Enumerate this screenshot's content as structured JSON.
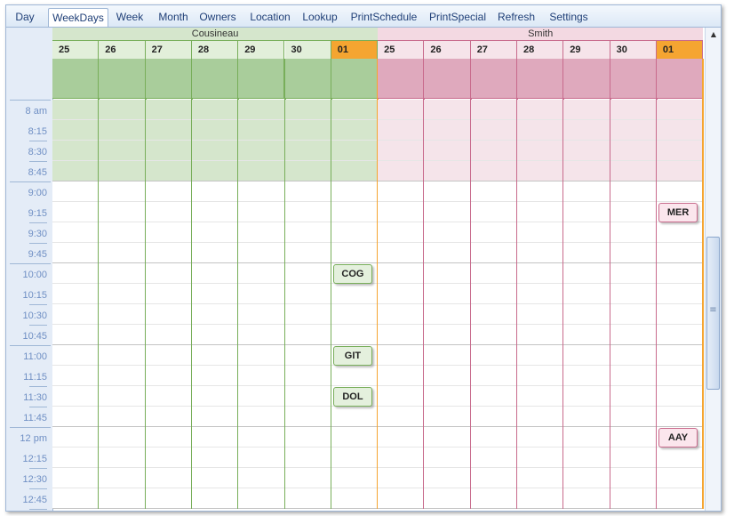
{
  "tabs": [
    {
      "label": "Day",
      "active": false
    },
    {
      "label": "WeekDays",
      "active": true
    },
    {
      "label": "Week",
      "active": false
    },
    {
      "label": "Month",
      "active": false
    },
    {
      "label": "Owners",
      "active": false
    },
    {
      "label": "Location",
      "active": false
    },
    {
      "label": "Lookup",
      "active": false
    },
    {
      "label": "PrintSchedule",
      "active": false
    },
    {
      "label": "PrintSpecial",
      "active": false
    },
    {
      "label": "Refresh",
      "active": false
    },
    {
      "label": "Settings",
      "active": false
    }
  ],
  "owners": [
    {
      "name": "Cousineau",
      "days": [
        "25",
        "26",
        "27",
        "28",
        "29",
        "30",
        "01"
      ],
      "today_index": 6,
      "colors": {
        "header": "#d5e6cc",
        "day_header": "#e2efda",
        "allday": "#a9cd9b",
        "work": "#d5e6cc",
        "line": "#78ae5a",
        "appt": "#e4f0dd"
      }
    },
    {
      "name": "Smith",
      "days": [
        "25",
        "26",
        "27",
        "28",
        "29",
        "30",
        "01"
      ],
      "today_index": 6,
      "colors": {
        "header": "#f3d9e2",
        "day_header": "#f6e4ea",
        "allday": "#dfa9bd",
        "work": "#f5e4ea",
        "line": "#c86a8c",
        "appt": "#fbe6ed"
      }
    }
  ],
  "today_color": "#f5a531",
  "times": [
    "8 am",
    "8:15",
    "8:30",
    "8:45",
    "9:00",
    "9:15",
    "9:30",
    "9:45",
    "10:00",
    "10:15",
    "10:30",
    "10:45",
    "11:00",
    "11:15",
    "11:30",
    "11:45",
    "12 pm",
    "12:15",
    "12:30",
    "12:45"
  ],
  "work_start_index": 4,
  "appointments": [
    {
      "label": "MER",
      "owner": 1,
      "day": 6,
      "time": "9:15"
    },
    {
      "label": "COG",
      "owner": 0,
      "day": 6,
      "time": "10:00"
    },
    {
      "label": "GIT",
      "owner": 0,
      "day": 6,
      "time": "11:00"
    },
    {
      "label": "DOL",
      "owner": 0,
      "day": 6,
      "time": "11:30"
    },
    {
      "label": "AAY",
      "owner": 1,
      "day": 6,
      "time": "12 pm"
    }
  ],
  "scrollbar": {
    "up_arrow": "▲",
    "grip": "≡"
  }
}
